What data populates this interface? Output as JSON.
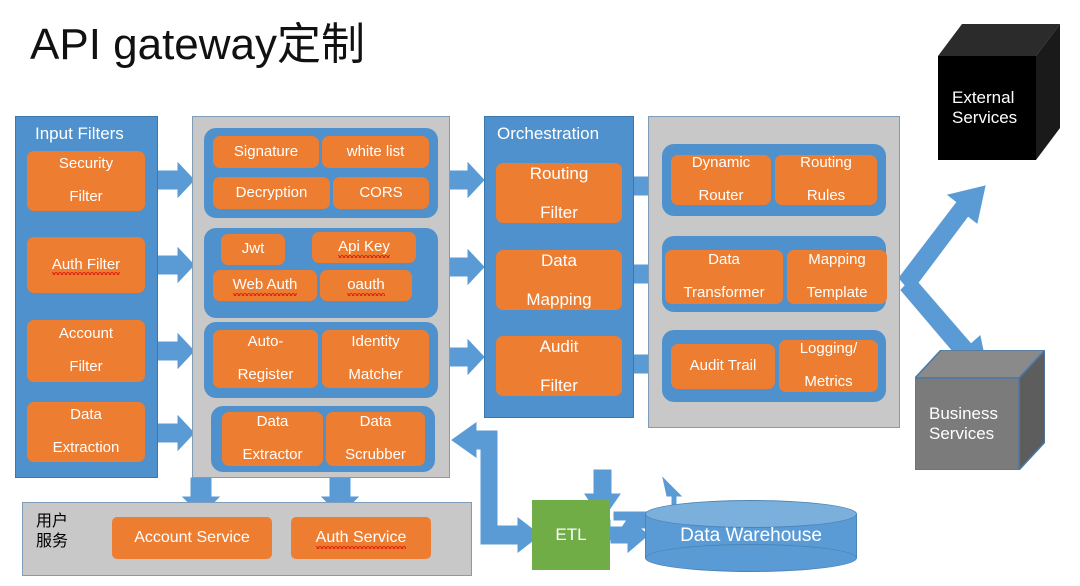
{
  "title": "API gateway定制",
  "colors": {
    "orange": "#ed7d31",
    "blue": "#4f91cd",
    "gray_panel": "#c8c8c8",
    "arrow_blue": "#5b9bd5",
    "etl_green": "#70ad47",
    "cube_black": "#000000",
    "cube_gray": "#7b7b7b",
    "spellcheck_red": "#e02b12"
  },
  "input_filters": {
    "panel_title": "Input Filters",
    "items": [
      {
        "label": "Security Filter",
        "lines": [
          "Security",
          "Filter"
        ],
        "misspelled": false
      },
      {
        "label": "Auth Filter",
        "lines": [
          "Auth Filter"
        ],
        "misspelled": true,
        "misspelled_word": "Auth"
      },
      {
        "label": "Account Filter",
        "lines": [
          "Account",
          "Filter"
        ],
        "misspelled": false
      },
      {
        "label": "Data Extraction",
        "lines": [
          "Data",
          "Extraction"
        ],
        "misspelled": false
      }
    ]
  },
  "filter_detail_panel": {
    "groups": [
      {
        "name": "security-group",
        "chips": [
          {
            "label": "Signature",
            "misspelled": false
          },
          {
            "label": "white list",
            "misspelled": false
          },
          {
            "label": "Decryption",
            "misspelled": false
          },
          {
            "label": "CORS",
            "misspelled": false
          }
        ]
      },
      {
        "name": "auth-group",
        "chips": [
          {
            "label": "Jwt",
            "misspelled": false
          },
          {
            "label": "Api Key",
            "misspelled": true,
            "misspelled_word": "Api"
          },
          {
            "label": "Web Auth",
            "misspelled": true,
            "misspelled_word": "Auth"
          },
          {
            "label": "oauth",
            "misspelled": true,
            "misspelled_word": "oauth"
          }
        ]
      },
      {
        "name": "account-group",
        "chips": [
          {
            "label": "Auto-Register",
            "lines": [
              "Auto-",
              "Register"
            ],
            "misspelled": false
          },
          {
            "label": "Identity Matcher",
            "lines": [
              "Identity",
              "Matcher"
            ],
            "misspelled": false
          }
        ]
      },
      {
        "name": "data-extraction-group",
        "chips": [
          {
            "label": "Data Extractor",
            "lines": [
              "Data",
              "Extractor"
            ],
            "misspelled": false
          },
          {
            "label": "Data Scrubber",
            "lines": [
              "Data",
              "Scrubber"
            ],
            "misspelled": false
          }
        ]
      }
    ]
  },
  "orchestration": {
    "panel_title": "Orchestration",
    "items": [
      {
        "label": "Routing Filter",
        "lines": [
          "Routing",
          "Filter"
        ]
      },
      {
        "label": "Data Mapping",
        "lines": [
          "Data",
          "Mapping"
        ]
      },
      {
        "label": "Audit Filter",
        "lines": [
          "Audit",
          "Filter"
        ]
      }
    ]
  },
  "orchestration_detail_panel": {
    "groups": [
      {
        "name": "routing-group",
        "chips": [
          {
            "label": "Dynamic Router",
            "lines": [
              "Dynamic",
              "Router"
            ]
          },
          {
            "label": "Routing Rules",
            "lines": [
              "Routing",
              "Rules"
            ]
          }
        ]
      },
      {
        "name": "mapping-group",
        "chips": [
          {
            "label": "Data Transformer",
            "lines": [
              "Data",
              "Transformer"
            ]
          },
          {
            "label": "Mapping Template",
            "lines": [
              "Mapping",
              "Template"
            ]
          }
        ]
      },
      {
        "name": "audit-group",
        "chips": [
          {
            "label": "Audit Trail",
            "lines": [
              "Audit Trail"
            ]
          },
          {
            "label": "Logging/ Metrics",
            "lines": [
              "Logging/",
              "Metrics"
            ]
          }
        ]
      }
    ]
  },
  "external_services": {
    "label": "External Services",
    "lines": [
      "External",
      "Services"
    ],
    "style": "black-cube"
  },
  "business_services": {
    "label": "Business Services",
    "lines": [
      "Business",
      "Services"
    ],
    "style": "gray-cube"
  },
  "user_services": {
    "panel_label": "用户服务",
    "panel_label_lines": [
      "用户",
      "服务"
    ],
    "items": [
      {
        "label": "Account Service",
        "misspelled": false
      },
      {
        "label": "Auth Service",
        "misspelled": true,
        "misspelled_word": "Auth"
      }
    ]
  },
  "etl": {
    "label": "ETL"
  },
  "data_warehouse": {
    "label": "Data Warehouse"
  }
}
